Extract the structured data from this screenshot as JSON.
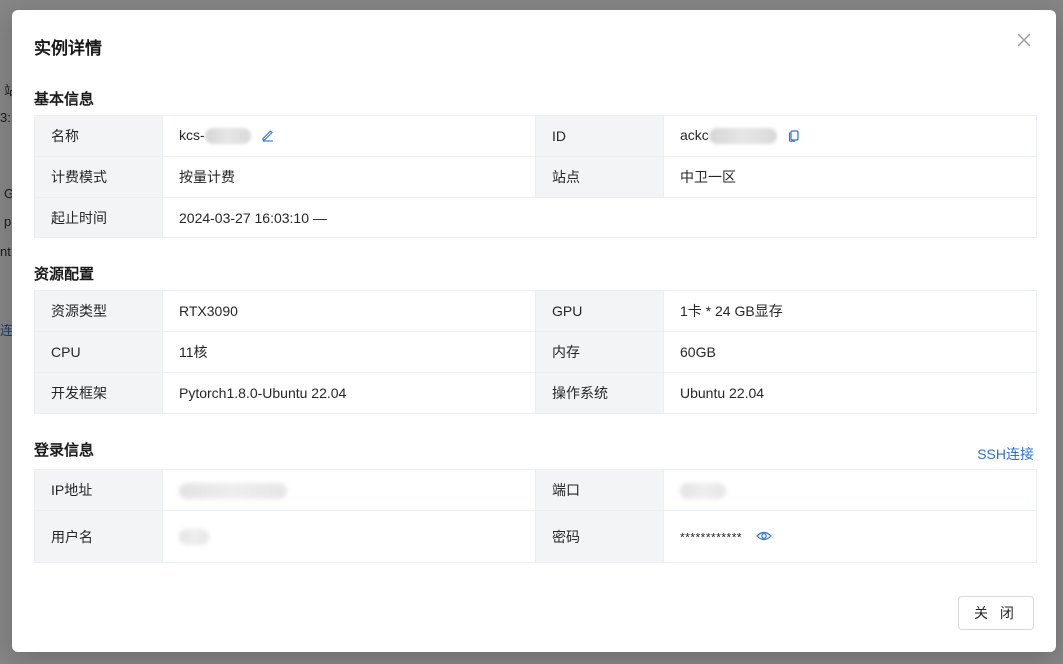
{
  "background": {
    "fragments": [
      "站",
      "3:1",
      "G",
      "p",
      "nt",
      "连接"
    ]
  },
  "modal": {
    "title": "实例详情",
    "close_label": "关 闭"
  },
  "basic_info": {
    "section_title": "基本信息",
    "name_label": "名称",
    "name_value": "kcs-",
    "id_label": "ID",
    "id_value": "ackc",
    "billing_label": "计费模式",
    "billing_value": "按量计费",
    "site_label": "站点",
    "site_value": "中卫一区",
    "period_label": "起止时间",
    "period_value": "2024-03-27 16:03:10 —"
  },
  "resources": {
    "section_title": "资源配置",
    "type_label": "资源类型",
    "type_value": "RTX3090",
    "gpu_label": "GPU",
    "gpu_value": "1卡 * 24 GB显存",
    "cpu_label": "CPU",
    "cpu_value": "11核",
    "memory_label": "内存",
    "memory_value": "60GB",
    "framework_label": "开发框架",
    "framework_value": "Pytorch1.8.0-Ubuntu 22.04",
    "os_label": "操作系统",
    "os_value": "Ubuntu 22.04"
  },
  "login": {
    "section_title": "登录信息",
    "ssh_link": "SSH连接",
    "ip_label": "IP地址",
    "port_label": "端口",
    "user_label": "用户名",
    "password_label": "密码",
    "password_value": "************"
  },
  "icons": {
    "edit": "edit-icon",
    "copy": "copy-icon",
    "eye": "eye-icon",
    "close": "close-icon"
  },
  "colors": {
    "accent": "#2f6fd6",
    "label_bg": "#f3f4f6",
    "border": "#ebeef2"
  }
}
